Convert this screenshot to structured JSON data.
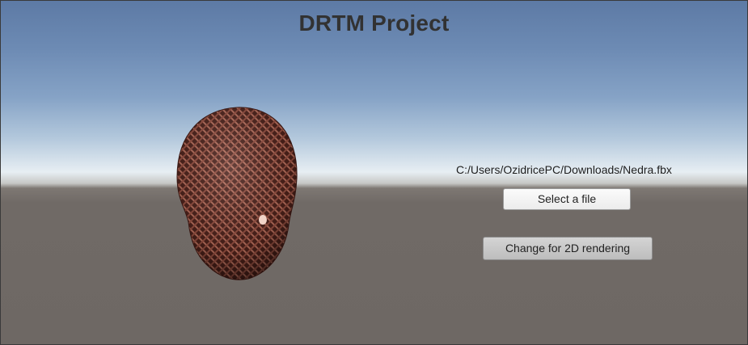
{
  "app": {
    "title": "DRTM Project"
  },
  "model": {
    "name": "head-mesh",
    "color": "#5a2a22"
  },
  "file_panel": {
    "path": "C:/Users/OzidricePC/Downloads/Nedra.fbx",
    "select_label": "Select a file",
    "render_toggle_label": "Change for 2D rendering"
  },
  "colors": {
    "sky_top": "#5d7aa5",
    "horizon": "#e7eef3",
    "ground": "#6e6864",
    "title_text": "#323232"
  }
}
